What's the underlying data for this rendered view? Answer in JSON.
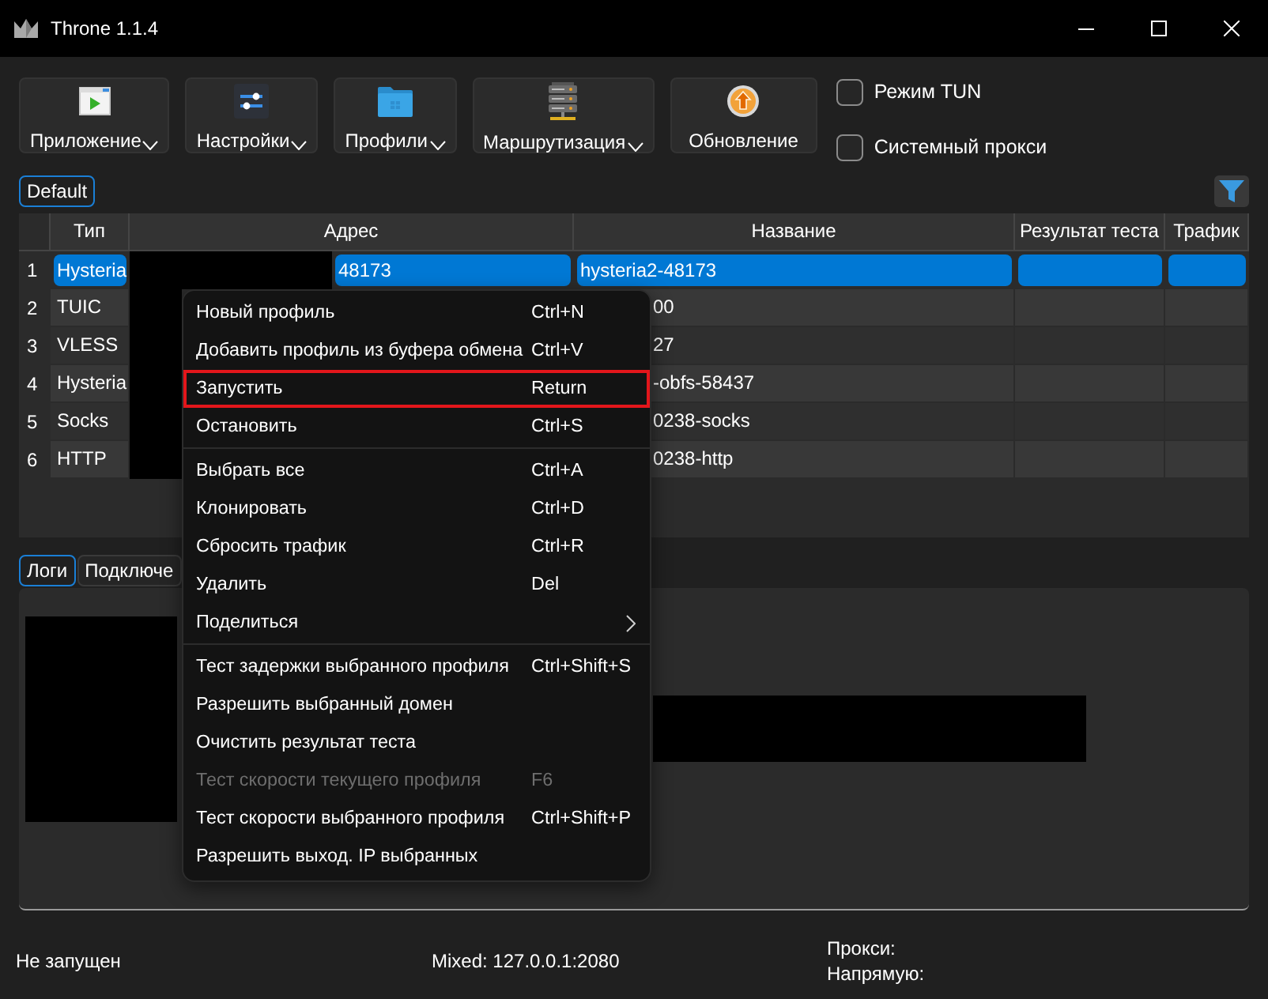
{
  "window": {
    "title": "Throne 1.1.4"
  },
  "toolbar": {
    "buttons": [
      {
        "label": "Приложение",
        "dropdown": true
      },
      {
        "label": "Настройки",
        "dropdown": true
      },
      {
        "label": "Профили",
        "dropdown": true
      },
      {
        "label": "Маршрутизация",
        "dropdown": true
      },
      {
        "label": "Обновление",
        "dropdown": false
      }
    ],
    "checkboxes": [
      {
        "label": "Режим TUN",
        "checked": false
      },
      {
        "label": "Системный прокси",
        "checked": false
      }
    ]
  },
  "group_tabs": [
    {
      "label": "Default",
      "selected": true
    }
  ],
  "table": {
    "columns": [
      "Тип",
      "Адрес",
      "Название",
      "Результат теста",
      "Трафик"
    ],
    "rows": [
      {
        "number": "1",
        "type": "Hysteria",
        "address": "48173",
        "name": "hysteria2-48173",
        "selected": true
      },
      {
        "number": "2",
        "type": "TUIC",
        "name": "00",
        "selected": false
      },
      {
        "number": "3",
        "type": "VLESS",
        "name": "27",
        "selected": false
      },
      {
        "number": "4",
        "type": "Hysteria",
        "name": "-obfs-58437",
        "selected": false
      },
      {
        "number": "5",
        "type": "Socks",
        "name": "0238-socks",
        "selected": false
      },
      {
        "number": "6",
        "type": "HTTP",
        "name": "0238-http",
        "selected": false
      }
    ]
  },
  "bottom_tabs": [
    {
      "label": "Логи",
      "selected": true
    },
    {
      "label": "Подключе",
      "selected": false
    }
  ],
  "context_menu": {
    "sections": [
      {
        "items": [
          {
            "label": "Новый профиль",
            "shortcut": "Ctrl+N",
            "disabled": false,
            "highlighted": false,
            "submenu": false
          },
          {
            "label": "Добавить профиль из буфера обмена",
            "shortcut": "Ctrl+V",
            "disabled": false,
            "highlighted": false,
            "submenu": false
          },
          {
            "label": "Запустить",
            "shortcut": "Return",
            "disabled": false,
            "highlighted": true,
            "submenu": false
          },
          {
            "label": "Остановить",
            "shortcut": "Ctrl+S",
            "disabled": false,
            "highlighted": false,
            "submenu": false
          }
        ]
      },
      {
        "items": [
          {
            "label": "Выбрать все",
            "shortcut": "Ctrl+A",
            "disabled": false,
            "highlighted": false,
            "submenu": false
          },
          {
            "label": "Клонировать",
            "shortcut": "Ctrl+D",
            "disabled": false,
            "highlighted": false,
            "submenu": false
          },
          {
            "label": "Сбросить трафик",
            "shortcut": "Ctrl+R",
            "disabled": false,
            "highlighted": false,
            "submenu": false
          },
          {
            "label": "Удалить",
            "shortcut": "Del",
            "disabled": false,
            "highlighted": false,
            "submenu": false
          },
          {
            "label": "Поделиться",
            "disabled": false,
            "highlighted": false,
            "submenu": true
          }
        ]
      },
      {
        "items": [
          {
            "label": "Тест задержки выбранного профиля",
            "shortcut": "Ctrl+Shift+S",
            "disabled": false,
            "highlighted": false,
            "submenu": false
          },
          {
            "label": "Разрешить выбранный домен",
            "disabled": false,
            "highlighted": false,
            "submenu": false
          },
          {
            "label": "Очистить результат теста",
            "disabled": false,
            "highlighted": false,
            "submenu": false
          },
          {
            "label": "Тест скорости текущего профиля",
            "shortcut": "F6",
            "disabled": true,
            "highlighted": false,
            "submenu": false
          },
          {
            "label": "Тест скорости выбранного профиля",
            "shortcut": "Ctrl+Shift+P",
            "disabled": false,
            "highlighted": false,
            "submenu": false
          },
          {
            "label": "Разрешить выход. IP выбранных",
            "disabled": false,
            "highlighted": false,
            "submenu": false
          }
        ]
      }
    ]
  },
  "status_bar": {
    "state": "Не запущен",
    "listen_address": "Mixed: 127.0.0.1:2080",
    "proxy_label": "Прокси:",
    "direct_label": "Напрямую:"
  }
}
